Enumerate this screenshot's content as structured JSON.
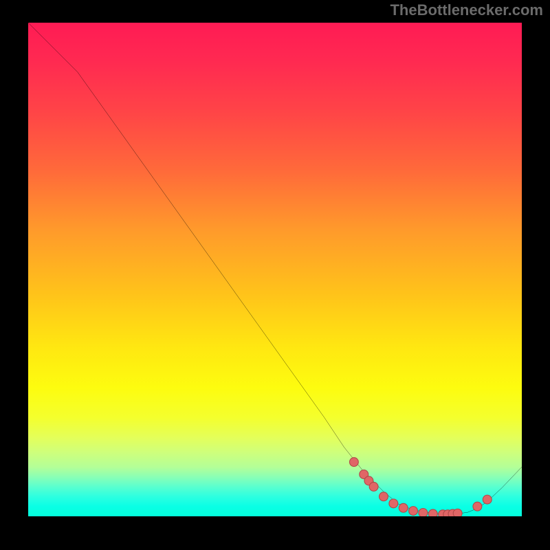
{
  "watermark": "TheBottlenecker.com",
  "colors": {
    "dot_fill": "#e06666",
    "dot_stroke": "#b04848",
    "line": "#000000"
  },
  "chart_data": {
    "type": "line",
    "title": "",
    "xlabel": "",
    "ylabel": "",
    "xlim": [
      0,
      100
    ],
    "ylim": [
      0,
      100
    ],
    "series": [
      {
        "name": "curve",
        "x": [
          0,
          3,
          6,
          10,
          15,
          20,
          25,
          30,
          35,
          40,
          45,
          50,
          55,
          60,
          64,
          68,
          72,
          75,
          78,
          82,
          86,
          89,
          91,
          93,
          96,
          100
        ],
        "y": [
          100,
          97,
          94,
          90,
          83,
          76,
          69,
          62,
          55,
          48,
          41,
          34,
          27,
          20,
          14,
          9,
          5,
          2.5,
          1.3,
          0.6,
          0.4,
          0.8,
          1.6,
          3.0,
          5.8,
          10
        ]
      }
    ],
    "dots": {
      "name": "optimal-range",
      "x": [
        66,
        68,
        69,
        70,
        72,
        74,
        76,
        78,
        80,
        82,
        84,
        85,
        86,
        87,
        91,
        93
      ],
      "y": [
        11,
        8.5,
        7.2,
        6.0,
        4.0,
        2.6,
        1.7,
        1.1,
        0.7,
        0.5,
        0.4,
        0.4,
        0.5,
        0.6,
        2.0,
        3.4
      ]
    }
  }
}
